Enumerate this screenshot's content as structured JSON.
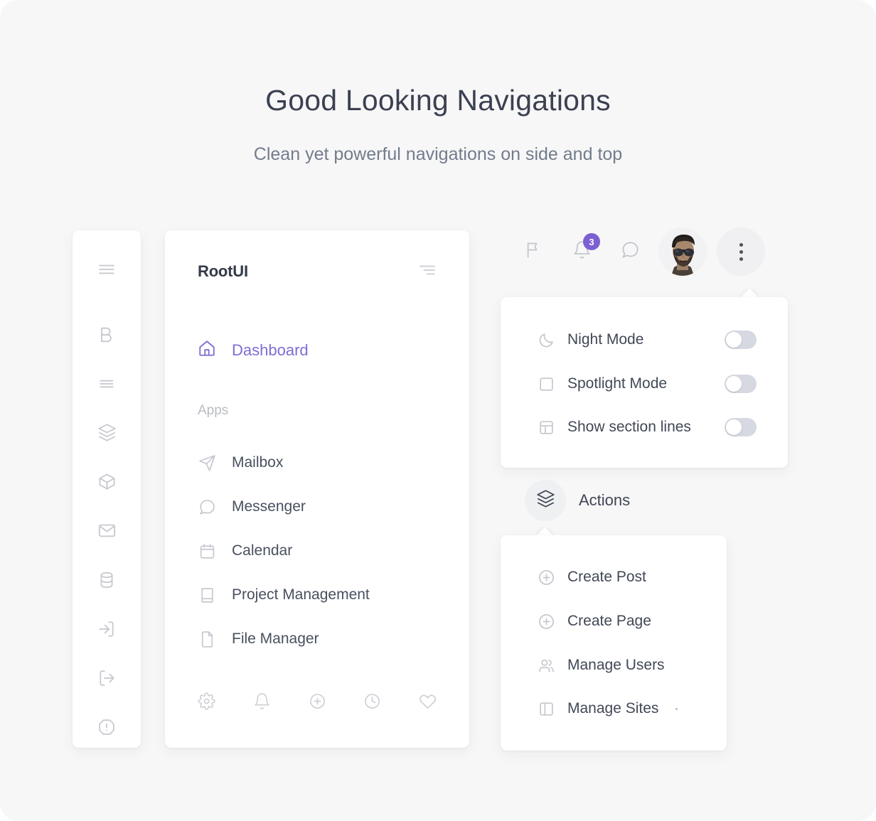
{
  "header": {
    "title": "Good Looking Navigations",
    "subtitle": "Clean yet powerful navigations on side and top"
  },
  "colors": {
    "page_background": "#f7f7f8",
    "card_background": "#ffffff",
    "accent_purple": "#7c6fd4",
    "badge_purple": "#7c5fd3",
    "icon_gray": "#c5c8cf",
    "text_dark": "#3b4151",
    "text_muted": "#737c8c",
    "toggle_track": "#d6d9e1"
  },
  "icon_rail": {
    "items": [
      {
        "name": "menu-icon",
        "label": "Menu"
      },
      {
        "name": "bold-b-logo-icon",
        "label": "B"
      },
      {
        "name": "align-justify-icon",
        "label": "Align Justify"
      },
      {
        "name": "layers-icon",
        "label": "Layers"
      },
      {
        "name": "box-icon",
        "label": "Box"
      },
      {
        "name": "mail-icon",
        "label": "Mail"
      },
      {
        "name": "database-icon",
        "label": "Database"
      },
      {
        "name": "log-in-icon",
        "label": "Log In"
      },
      {
        "name": "log-out-icon",
        "label": "Log Out"
      },
      {
        "name": "alert-octagon-icon",
        "label": "Alert"
      }
    ]
  },
  "sidebar": {
    "brand": "RootUI",
    "collapse_icon": "align-right-icon",
    "active_item": {
      "label": "Dashboard",
      "icon": "home-icon"
    },
    "section_label": "Apps",
    "items": [
      {
        "label": "Mailbox",
        "icon": "send-icon"
      },
      {
        "label": "Messenger",
        "icon": "message-circle-icon"
      },
      {
        "label": "Calendar",
        "icon": "calendar-icon"
      },
      {
        "label": "Project Management",
        "icon": "book-icon"
      },
      {
        "label": "File Manager",
        "icon": "file-icon"
      }
    ],
    "footer_icons": [
      {
        "name": "settings-gear-icon",
        "label": "Settings"
      },
      {
        "name": "bell-icon",
        "label": "Notifications"
      },
      {
        "name": "plus-circle-icon",
        "label": "Add"
      },
      {
        "name": "clock-icon",
        "label": "History"
      },
      {
        "name": "heart-icon",
        "label": "Favorites"
      }
    ]
  },
  "topbar": {
    "flag": {
      "name": "flag-icon",
      "label": "Flag"
    },
    "notifications": {
      "name": "bell-icon",
      "label": "Notifications",
      "badge": "3"
    },
    "messages": {
      "name": "message-circle-icon",
      "label": "Messages"
    },
    "avatar": {
      "name": "avatar",
      "label": "User avatar"
    },
    "more": {
      "name": "more-vertical-icon",
      "label": "More options"
    }
  },
  "settings_menu": {
    "options": [
      {
        "label": "Night Mode",
        "icon": "moon-icon",
        "enabled": false
      },
      {
        "label": "Spotlight Mode",
        "icon": "square-icon",
        "enabled": false
      },
      {
        "label": "Show section lines",
        "icon": "layout-icon",
        "enabled": false
      }
    ]
  },
  "actions": {
    "trigger_label": "Actions",
    "trigger_icon": "layers-icon",
    "items": [
      {
        "label": "Create Post",
        "icon": "plus-circle-icon"
      },
      {
        "label": "Create Page",
        "icon": "plus-circle-icon"
      },
      {
        "label": "Manage Users",
        "icon": "users-icon"
      },
      {
        "label": "Manage Sites",
        "icon": "sidebar-icon"
      }
    ]
  }
}
